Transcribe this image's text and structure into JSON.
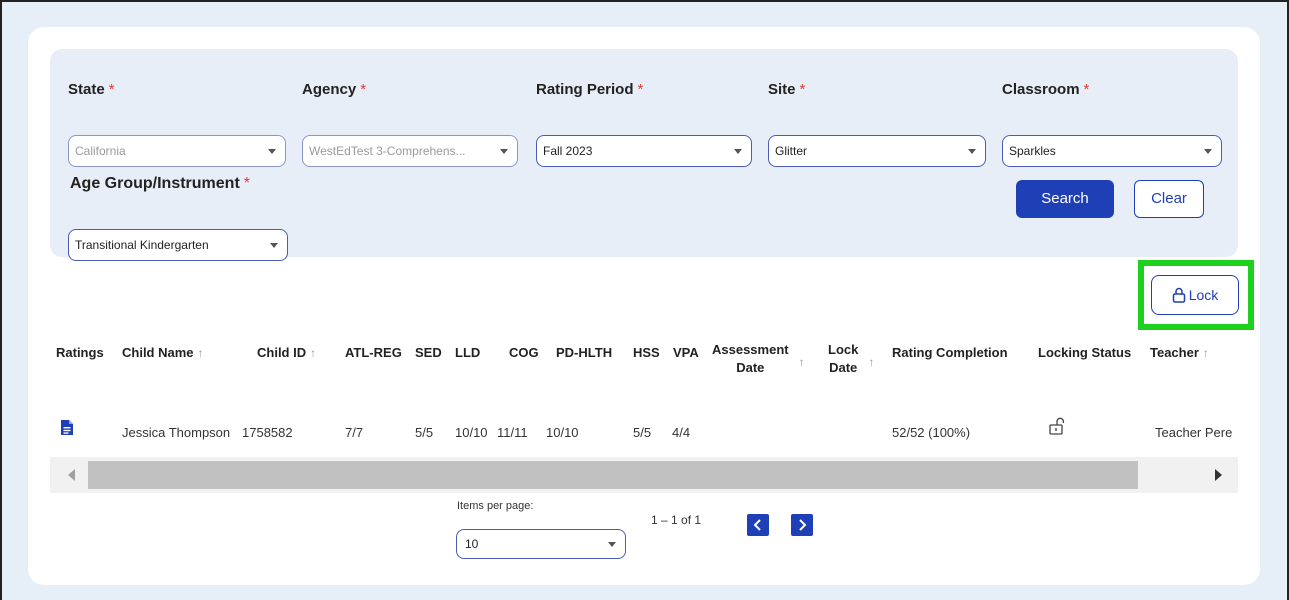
{
  "filters": {
    "state": {
      "label": "State",
      "value": "California"
    },
    "agency": {
      "label": "Agency",
      "value": "WestEdTest 3-Comprehens..."
    },
    "rating_period": {
      "label": "Rating Period",
      "value": "Fall 2023"
    },
    "site": {
      "label": "Site",
      "value": "Glitter"
    },
    "classroom": {
      "label": "Classroom",
      "value": "Sparkles"
    },
    "age_group": {
      "label": "Age Group/Instrument",
      "value": "Transitional Kindergarten"
    },
    "required_mark": "*"
  },
  "buttons": {
    "search": "Search",
    "clear": "Clear",
    "lock": "Lock"
  },
  "table": {
    "columns": {
      "ratings": "Ratings",
      "child_name": "Child Name",
      "child_id": "Child ID",
      "atl_reg": "ATL-REG",
      "sed": "SED",
      "lld": "LLD",
      "cog": "COG",
      "pd_hlth": "PD-HLTH",
      "hss": "HSS",
      "vpa": "VPA",
      "assessment_date_1": "Assessment",
      "assessment_date_2": "Date",
      "lock_date_1": "Lock",
      "lock_date_2": "Date",
      "rating_completion": "Rating Completion",
      "locking_status": "Locking Status",
      "teacher": "Teacher"
    },
    "sort_icon": "↑",
    "rows": [
      {
        "child_name": "Jessica Thompson",
        "child_id": "1758582",
        "atl_reg": "7/7",
        "sed": "5/5",
        "lld": "10/10",
        "cog": "11/11",
        "pd_hlth": "10/10",
        "hss": "5/5",
        "vpa": "4/4",
        "rating_completion": "52/52 (100%)",
        "locking_status": "unlocked",
        "teacher": "Teacher Pere"
      }
    ]
  },
  "pagination": {
    "items_per_page_label": "Items per page:",
    "items_per_page": "10",
    "range": "1 – 1 of 1"
  },
  "colors": {
    "accent": "#1f3fb6",
    "highlight": "#1fd11f",
    "required": "#e53935"
  }
}
